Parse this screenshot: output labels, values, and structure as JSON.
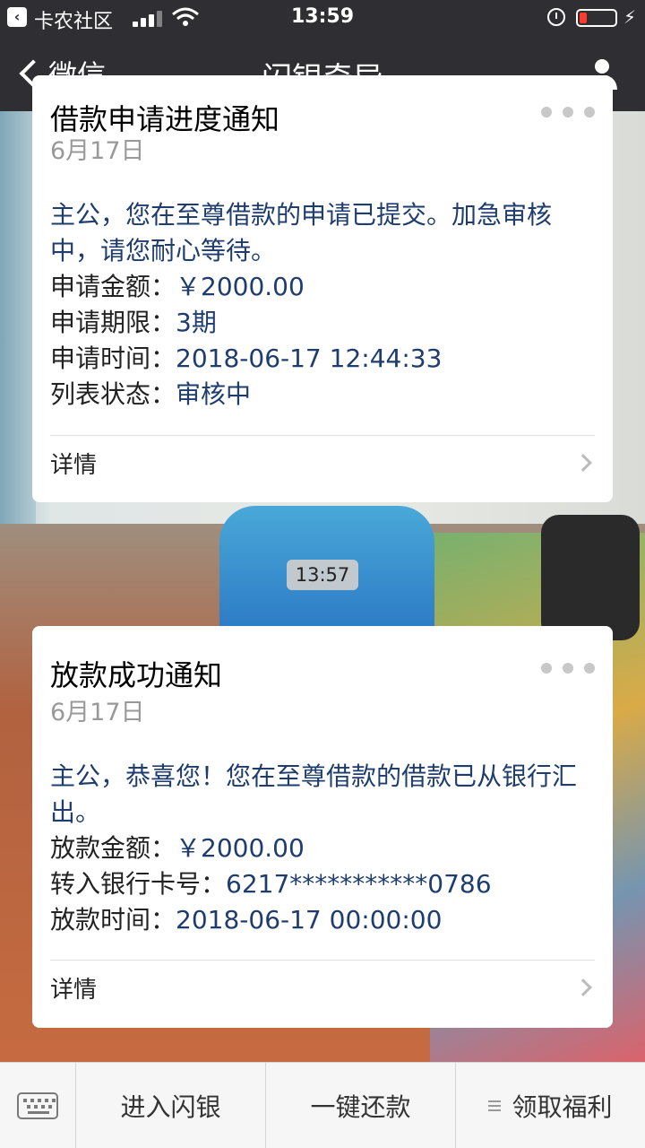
{
  "status_bar": {
    "back_app": "卡农社区",
    "time": "13:59"
  },
  "nav": {
    "back_label": "微信",
    "title": "闪银奇异"
  },
  "messages": [
    {
      "title": "借款申请进度通知",
      "date": "6月17日",
      "intro": "主公，您在至尊借款的申请已提交。加急审核中，请您耐心等待。",
      "fields": [
        {
          "label": "申请金额：",
          "value": "￥2000.00"
        },
        {
          "label": "申请期限：",
          "value": "3期"
        },
        {
          "label": "申请时间：",
          "value": "2018-06-17 12:44:33"
        },
        {
          "label": "列表状态：",
          "value": "审核中"
        }
      ],
      "detail_label": "详情"
    },
    {
      "title": "放款成功通知",
      "date": "6月17日",
      "intro": "主公，恭喜您！您在至尊借款的借款已从银行汇出。",
      "fields": [
        {
          "label": "放款金额：",
          "value": "￥2000.00"
        },
        {
          "label": "转入银行卡号：",
          "value": "6217***********0786"
        },
        {
          "label": "放款时间：",
          "value": "2018-06-17 00:00:00"
        }
      ],
      "detail_label": "详情"
    }
  ],
  "time_divider": "13:57",
  "menu": {
    "items": [
      "进入闪银",
      "一键还款",
      "领取福利"
    ]
  },
  "colors": {
    "bar_bg": "#2e2e33",
    "value_text": "#1e3d6e",
    "battery_low": "#ff3b30"
  }
}
